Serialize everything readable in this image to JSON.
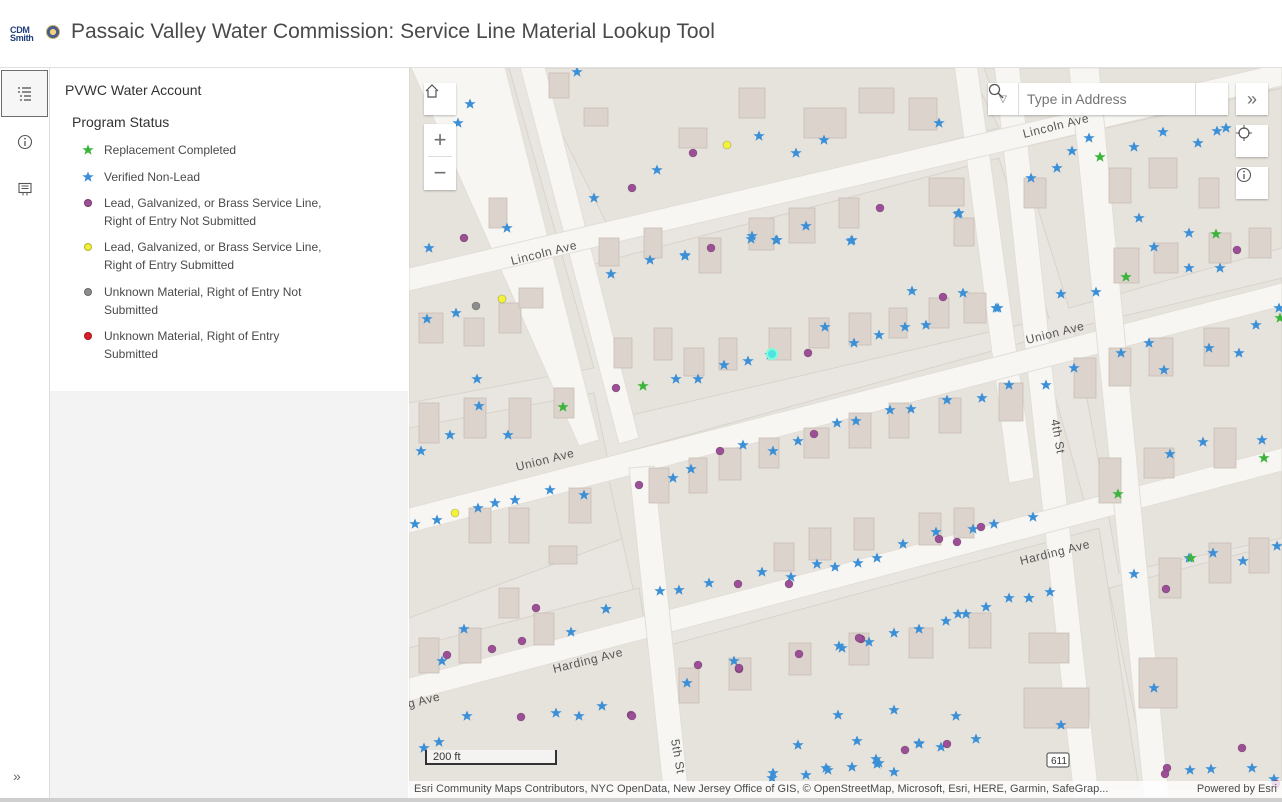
{
  "header": {
    "logo_text_line1": "CDM",
    "logo_text_line2": "Smith",
    "title": "Passaic Valley Water Commission: Service Line Material Lookup Tool"
  },
  "action_bar": {
    "items": [
      {
        "name": "legend",
        "icon": "legend-icon",
        "active": true
      },
      {
        "name": "about",
        "icon": "info-icon",
        "active": false
      },
      {
        "name": "layers",
        "icon": "map-layers-icon",
        "active": false
      }
    ],
    "collapse_icon": "double-chevron-icon"
  },
  "legend": {
    "layer_title": "PVWC Water Account",
    "group_title": "Program Status",
    "items": [
      {
        "label": "Replacement Completed",
        "symbol": "star",
        "color": "#3cb43c"
      },
      {
        "label": "Verified Non-Lead",
        "symbol": "star",
        "color": "#3a8fd6"
      },
      {
        "label": "Lead, Galvanized, or Brass Service Line, Right of Entry Not Submitted",
        "symbol": "circle",
        "color": "#9c4f96"
      },
      {
        "label": "Lead, Galvanized, or Brass Service Line, Right of Entry Submitted",
        "symbol": "circle",
        "color": "#f2f23a"
      },
      {
        "label": "Unknown Material, Right of Entry Not Submitted",
        "symbol": "circle",
        "color": "#8c8c8c"
      },
      {
        "label": "Unknown Material, Right of Entry Submitted",
        "symbol": "circle",
        "color": "#d6202a"
      }
    ]
  },
  "map": {
    "search_placeholder": "Type in Address",
    "streets": {
      "lincoln_ave_1": "Lincoln Ave",
      "lincoln_ave_2": "Lincoln Ave",
      "union_ave_1": "Union Ave",
      "union_ave_2": "Union Ave",
      "harding_ave_1": "Harding Ave",
      "harding_ave_2": "Harding Ave",
      "harding_ave_3": "g Ave",
      "fourth_st": "4th St",
      "fifth_st": "5th St",
      "route_shield": "611"
    },
    "scale_label": "200 ft",
    "attribution": "Esri Community Maps Contributors, NYC OpenData, New Jersey Office of GIS, © OpenStreetMap, Microsoft, Esri, HERE, Garmin, SafeGrap...",
    "powered_by": "Powered by Esri",
    "colors": {
      "star_blue": "#3a8fd6",
      "star_green": "#3cb43c",
      "dot_purple": "#9c4f96",
      "dot_yellow": "#f2f23a",
      "dot_gray": "#8c8c8c",
      "selected_cyan": "#4ee3e0"
    }
  }
}
